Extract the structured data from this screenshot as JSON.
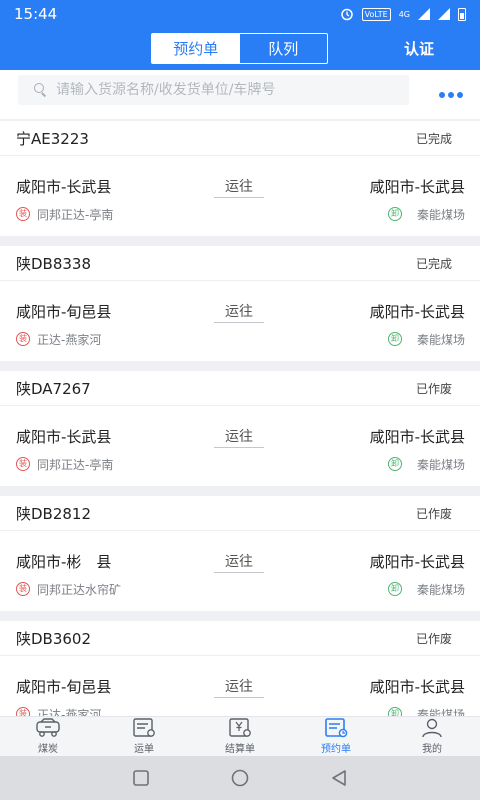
{
  "status_bar": {
    "time": "15:44",
    "volte": "VoLTE",
    "network": "4G"
  },
  "header": {
    "tabs": [
      {
        "label": "预约单",
        "active": true
      },
      {
        "label": "队列",
        "active": false
      }
    ],
    "cert_label": "认证"
  },
  "search": {
    "placeholder": "请输入货源名称/收发货单位/车牌号"
  },
  "labels": {
    "direction": "运往",
    "load_badge": "装",
    "unload_badge": "卸"
  },
  "orders": [
    {
      "plate": "宁AE3223",
      "status": "已完成",
      "from_city": "咸阳市-长武县",
      "to_city": "咸阳市-长武县",
      "load_place": "同邦正达-亭南",
      "unload_place": "秦能煤场"
    },
    {
      "plate": "陕DB8338",
      "status": "已完成",
      "from_city": "咸阳市-旬邑县",
      "to_city": "咸阳市-长武县",
      "load_place": "正达-燕家河",
      "unload_place": "秦能煤场"
    },
    {
      "plate": "陕DA7267",
      "status": "已作废",
      "from_city": "咸阳市-长武县",
      "to_city": "咸阳市-长武县",
      "load_place": "同邦正达-亭南",
      "unload_place": "秦能煤场"
    },
    {
      "plate": "陕DB2812",
      "status": "已作废",
      "from_city": "咸阳市-彬　县",
      "to_city": "咸阳市-长武县",
      "load_place": "同邦正达水帘矿",
      "unload_place": "秦能煤场"
    },
    {
      "plate": "陕DB3602",
      "status": "已作废",
      "from_city": "咸阳市-旬邑县",
      "to_city": "咸阳市-长武县",
      "load_place": "正达-燕家河",
      "unload_place": "秦能煤场"
    }
  ],
  "tabbar": {
    "items": [
      {
        "label": "煤炭",
        "icon": "coal-truck-icon",
        "active": false
      },
      {
        "label": "运单",
        "icon": "waybill-icon",
        "active": false
      },
      {
        "label": "结算单",
        "icon": "settlement-icon",
        "active": false
      },
      {
        "label": "预约单",
        "icon": "reservation-icon",
        "active": true
      },
      {
        "label": "我的",
        "icon": "user-icon",
        "active": false
      }
    ]
  },
  "colors": {
    "brand": "#2a7ef5",
    "load": "#e35757",
    "unload": "#4fb56f",
    "background": "#eef0f3"
  }
}
